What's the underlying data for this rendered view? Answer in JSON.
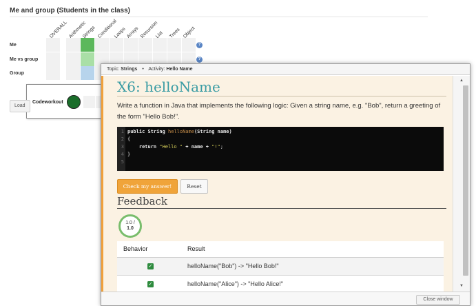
{
  "page": {
    "heading": "Me and group (Students in the class)"
  },
  "grid": {
    "columns": [
      "OVERALL",
      "Arithmetic",
      "Strings",
      "Conditional",
      "Loops",
      "Arrays",
      "Recursion",
      "List",
      "Trees",
      "Object"
    ],
    "rows": [
      "Me",
      "Me vs group",
      "Group"
    ],
    "help_glyph": "?"
  },
  "codeworkout": {
    "label": "Codeworkout"
  },
  "load_button": {
    "label": "Load"
  },
  "modal": {
    "topic_label": "Topic:",
    "topic_value": "Strings",
    "separator": "•",
    "activity_label": "Activity:",
    "activity_value": "Hello Name",
    "exercise_title": "X6: helloName",
    "prompt": "Write a function in Java that implements the following logic: Given a string name, e.g. \"Bob\", return a greeting of the form \"Hello Bob!\".",
    "code": {
      "line_numbers": [
        "1",
        "2",
        "3",
        "4",
        "5"
      ],
      "line1_kw": "public String ",
      "line1_fn": "helloName",
      "line1_rest": "(String name)",
      "line2": "{",
      "line3_kw": "    return ",
      "line3_str1": "\"Hello \"",
      "line3_mid": " + name + ",
      "line3_str2": "\"!\"",
      "line3_end": ";",
      "line4": "}",
      "line5": ""
    },
    "check_button": "Check my answer!",
    "reset_button": "Reset",
    "feedback_heading": "Feedback",
    "score_top": "1.0 /",
    "score_bottom": "1.0",
    "table": {
      "header_behavior": "Behavior",
      "header_result": "Result",
      "rows": [
        {
          "result": "helloName(\"Bob\") -> \"Hello Bob!\""
        },
        {
          "result": "helloName(\"Alice\") -> \"Hello Alice!\""
        }
      ]
    },
    "close_button": "Close window"
  },
  "colors": {
    "accent_orange": "#f0a43a",
    "title_teal": "#3a9ca4",
    "pass_green": "#2e8b3e",
    "grid_strong_green": "#5cb85c"
  },
  "icons": {
    "help": "help-icon",
    "check": "check-icon",
    "scroll_up": "chevron-up-icon",
    "scroll_down": "chevron-down-icon"
  }
}
